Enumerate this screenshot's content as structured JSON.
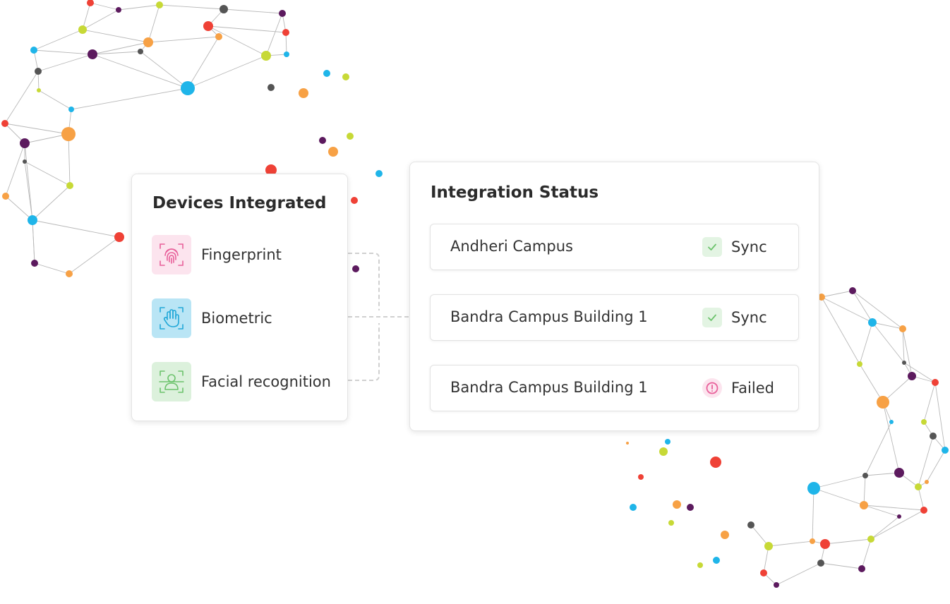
{
  "devices": {
    "title": "Devices Integrated",
    "items": [
      {
        "label": "Fingerprint",
        "icon": "fingerprint-icon",
        "color": "#e8609a",
        "bg": "#fce4ee"
      },
      {
        "label": "Biometric",
        "icon": "hand-icon",
        "color": "#22a8d8",
        "bg": "#b9e5f5"
      },
      {
        "label": "Facial recognition",
        "icon": "face-scan-icon",
        "color": "#6cc36c",
        "bg": "#dcf1dc"
      }
    ]
  },
  "integration": {
    "title": "Integration Status",
    "rows": [
      {
        "campus": "Andheri Campus",
        "status": "Sync",
        "icon": "check-icon"
      },
      {
        "campus": "Bandra Campus Building 1",
        "status": "Sync",
        "icon": "check-icon"
      },
      {
        "campus": "Bandra Campus Building 1",
        "status": "Failed",
        "icon": "alert-icon"
      }
    ]
  },
  "colors": {
    "sync_bg": "#e3f4e3",
    "sync_fg": "#6cc36c",
    "failed_bg": "#fce4ee",
    "failed_fg": "#e8609a",
    "node_palette": [
      "#ef4136",
      "#f7a145",
      "#c7d936",
      "#1fb5e9",
      "#5c1a5e",
      "#555555"
    ]
  }
}
